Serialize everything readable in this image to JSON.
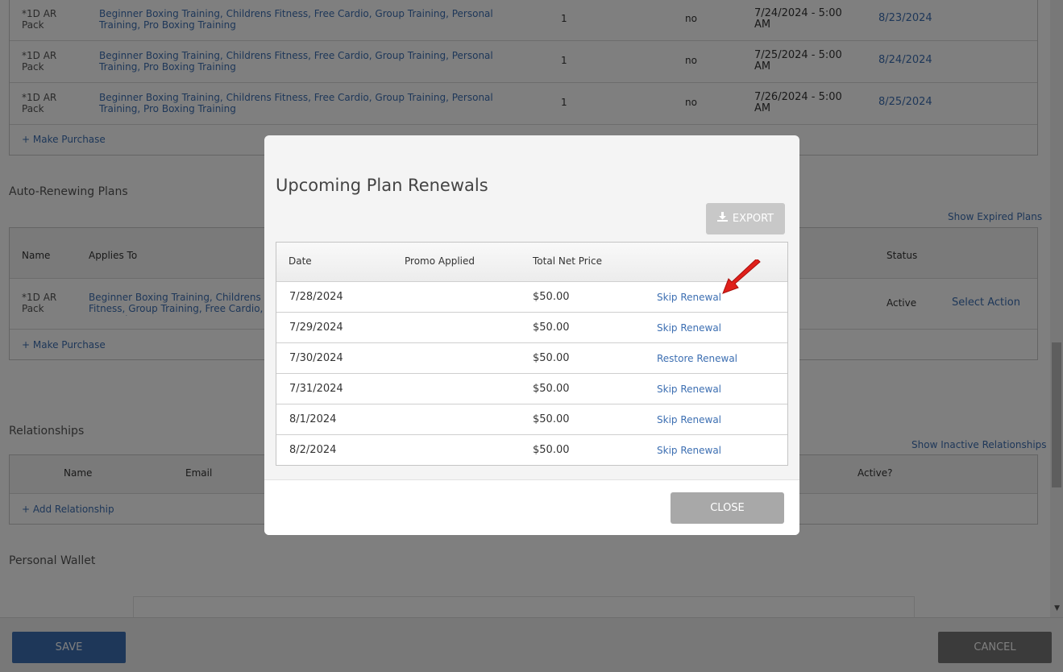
{
  "purchases": {
    "rows": [
      {
        "name": "*1D AR Pack",
        "applies_to": "Beginner Boxing Training, Childrens Fitness, Free Cardio, Group Training, Personal Training, Pro Boxing Training",
        "qty": "1",
        "flag": "no",
        "start": "7/24/2024 - 5:00 AM",
        "end": "8/23/2024"
      },
      {
        "name": "*1D AR Pack",
        "applies_to": "Beginner Boxing Training, Childrens Fitness, Free Cardio, Group Training, Personal Training, Pro Boxing Training",
        "qty": "1",
        "flag": "no",
        "start": "7/25/2024 - 5:00 AM",
        "end": "8/24/2024"
      },
      {
        "name": "*1D AR Pack",
        "applies_to": "Beginner Boxing Training, Childrens Fitness, Free Cardio, Group Training, Personal Training, Pro Boxing Training",
        "qty": "1",
        "flag": "no",
        "start": "7/26/2024 - 5:00 AM",
        "end": "8/25/2024"
      }
    ],
    "make_purchase": "+ Make Purchase"
  },
  "auto_renewing": {
    "title": "Auto-Renewing Plans",
    "show_expired": "Show Expired Plans",
    "headers": {
      "name": "Name",
      "applies_to": "Applies To",
      "status": "Status"
    },
    "row": {
      "name": "*1D AR Pack",
      "applies_to": "Beginner Boxing Training, Childrens Fitness, Group Training, Free Cardio, Pro Boxing",
      "status": "Active",
      "action": "Select Action"
    },
    "make_purchase": "+ Make Purchase"
  },
  "relationships": {
    "title": "Relationships",
    "show_inactive": "Show Inactive Relationships",
    "headers": {
      "name": "Name",
      "email": "Email",
      "active": "Active?"
    },
    "add": "+ Add Relationship"
  },
  "wallet": {
    "title": "Personal Wallet"
  },
  "footer": {
    "save": "SAVE",
    "cancel": "CANCEL"
  },
  "modal": {
    "title": "Upcoming Plan Renewals",
    "export": "EXPORT",
    "export_icon": "download-icon",
    "headers": {
      "date": "Date",
      "promo": "Promo Applied",
      "price": "Total Net Price"
    },
    "rows": [
      {
        "date": "7/28/2024",
        "promo": "",
        "price": "$50.00",
        "action": "Skip Renewal"
      },
      {
        "date": "7/29/2024",
        "promo": "",
        "price": "$50.00",
        "action": "Skip Renewal"
      },
      {
        "date": "7/30/2024",
        "promo": "",
        "price": "$50.00",
        "action": "Restore Renewal"
      },
      {
        "date": "7/31/2024",
        "promo": "",
        "price": "$50.00",
        "action": "Skip Renewal"
      },
      {
        "date": "8/1/2024",
        "promo": "",
        "price": "$50.00",
        "action": "Skip Renewal"
      },
      {
        "date": "8/2/2024",
        "promo": "",
        "price": "$50.00",
        "action": "Skip Renewal"
      }
    ],
    "close": "CLOSE"
  },
  "colors": {
    "link": "#3d6fb2",
    "annotation_arrow": "#e0201b"
  }
}
